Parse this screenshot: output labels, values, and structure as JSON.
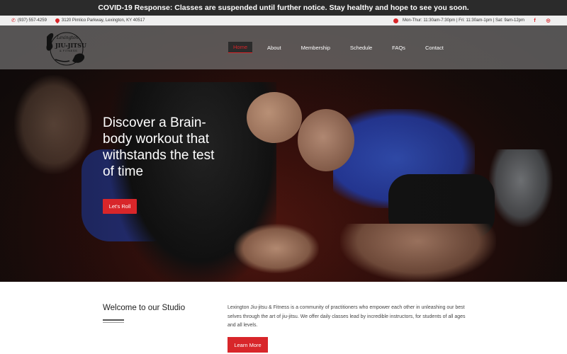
{
  "banner": {
    "text": "COVID-19 Response: Classes are suspended until further notice. Stay healthy and hope to see you soon."
  },
  "infobar": {
    "phone": "(937) 557-4259",
    "address": "3120 Pimlico Parkway, Lexington, KY 40517",
    "hours": "Mon-Thur: 11:30am-7:30pm | Fri: 11:30am-1pm | Sat: 9am-12pm",
    "social": [
      {
        "name": "facebook-icon",
        "glyph": "f"
      },
      {
        "name": "instagram-icon",
        "glyph": "◎"
      }
    ]
  },
  "logo": {
    "line1": "Lexington",
    "line2": "JIU-JITSU",
    "line3": "& FITNESS"
  },
  "nav": {
    "items": [
      {
        "label": "Home",
        "active": true
      },
      {
        "label": "About",
        "active": false
      },
      {
        "label": "Membership",
        "active": false
      },
      {
        "label": "Schedule",
        "active": false
      },
      {
        "label": "FAQs",
        "active": false
      },
      {
        "label": "Contact",
        "active": false
      }
    ]
  },
  "hero": {
    "headline": "Discover a Brain-body workout that withstands the test of time",
    "cta": "Let's Roll"
  },
  "welcome": {
    "title": "Welcome to our Studio",
    "body": "Lexington Jiu-jitsu & Fitness is a community of practitioners who empower each other in unleashing our best selves through the art of jiu-jitsu.  We offer daily classes lead by incredible instructors, for students of all ages and all levels.",
    "button": "Learn More"
  },
  "colors": {
    "accent": "#d8262a",
    "banner_bg": "#2b2b2b"
  }
}
